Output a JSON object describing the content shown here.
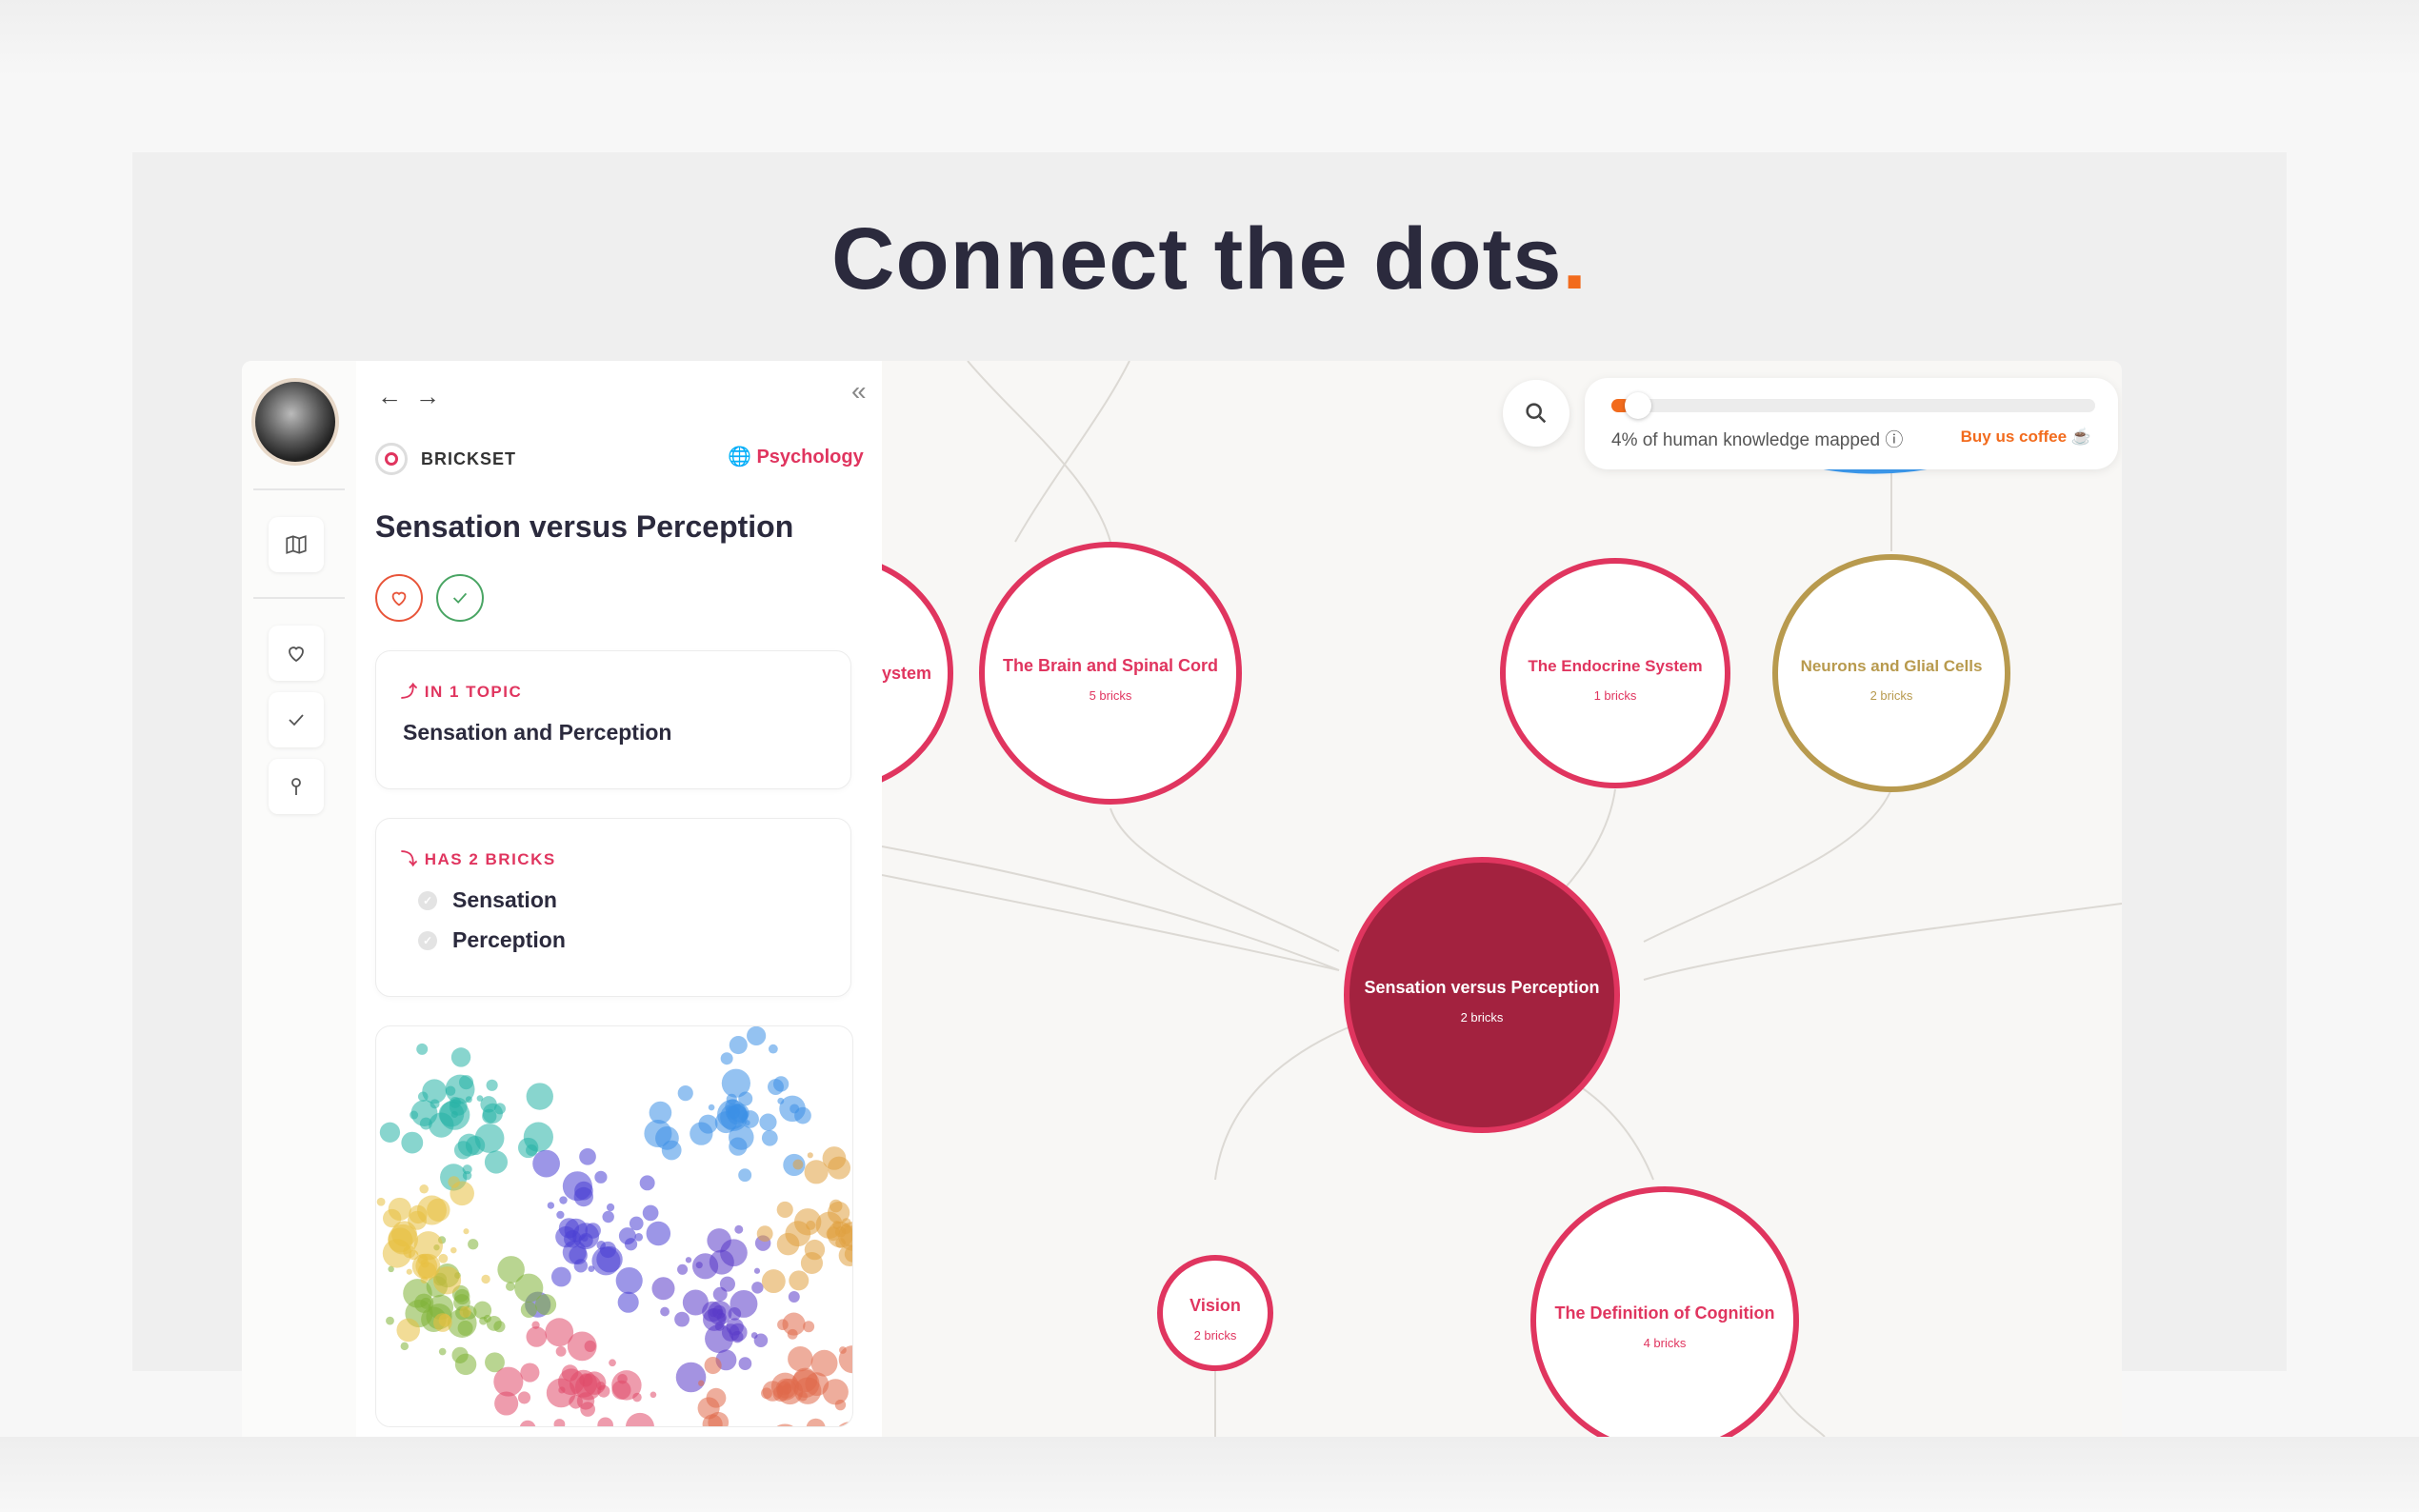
{
  "headline": {
    "text": "Connect the dots",
    "accent": "."
  },
  "sidebar": {
    "buttons": [
      {
        "name": "map",
        "icon": "map-icon"
      },
      {
        "name": "favorites",
        "icon": "heart-icon"
      },
      {
        "name": "completed",
        "icon": "check-icon"
      },
      {
        "name": "pinned",
        "icon": "pin-icon"
      }
    ]
  },
  "panel": {
    "back": "←",
    "forward": "→",
    "collapse": "«",
    "brickset_label": "BRICKSET",
    "subject": "Psychology",
    "title": "Sensation versus Perception",
    "topic_card": {
      "heading": "IN 1 TOPIC",
      "heading_icon": "⤴",
      "topic": "Sensation and Perception"
    },
    "bricks_card": {
      "heading": "HAS 2 BRICKS",
      "heading_icon": "⤵",
      "bricks": [
        "Sensation",
        "Perception"
      ]
    }
  },
  "progress": {
    "percent": 4,
    "label": "4% of human knowledge mapped",
    "info_icon": "ⓘ",
    "coffee": "Buy us coffee",
    "coffee_icon": "☕"
  },
  "graph": {
    "nodes": [
      {
        "id": "partial",
        "title": "ystem",
        "subtitle": "",
        "kind": "pink"
      },
      {
        "id": "brain",
        "title": "The Brain and Spinal Cord",
        "subtitle": "5 bricks",
        "kind": "pink"
      },
      {
        "id": "endocrine",
        "title": "The Endocrine System",
        "subtitle": "1 bricks",
        "kind": "pink"
      },
      {
        "id": "neurons",
        "title": "Neurons and Glial Cells",
        "subtitle": "2 bricks",
        "kind": "gold"
      },
      {
        "id": "center",
        "title": "Sensation versus Perception",
        "subtitle": "2 bricks",
        "kind": "active"
      },
      {
        "id": "vision",
        "title": "Vision",
        "subtitle": "2 bricks",
        "kind": "pink"
      },
      {
        "id": "cognition",
        "title": "The Definition of Cognition",
        "subtitle": "4 bricks",
        "kind": "pink"
      }
    ]
  },
  "colors": {
    "accent": "#e0355f",
    "orange": "#f26b1d",
    "gold": "#b89a4e",
    "active": "#a3223f",
    "blue": "#3d9bf0"
  }
}
